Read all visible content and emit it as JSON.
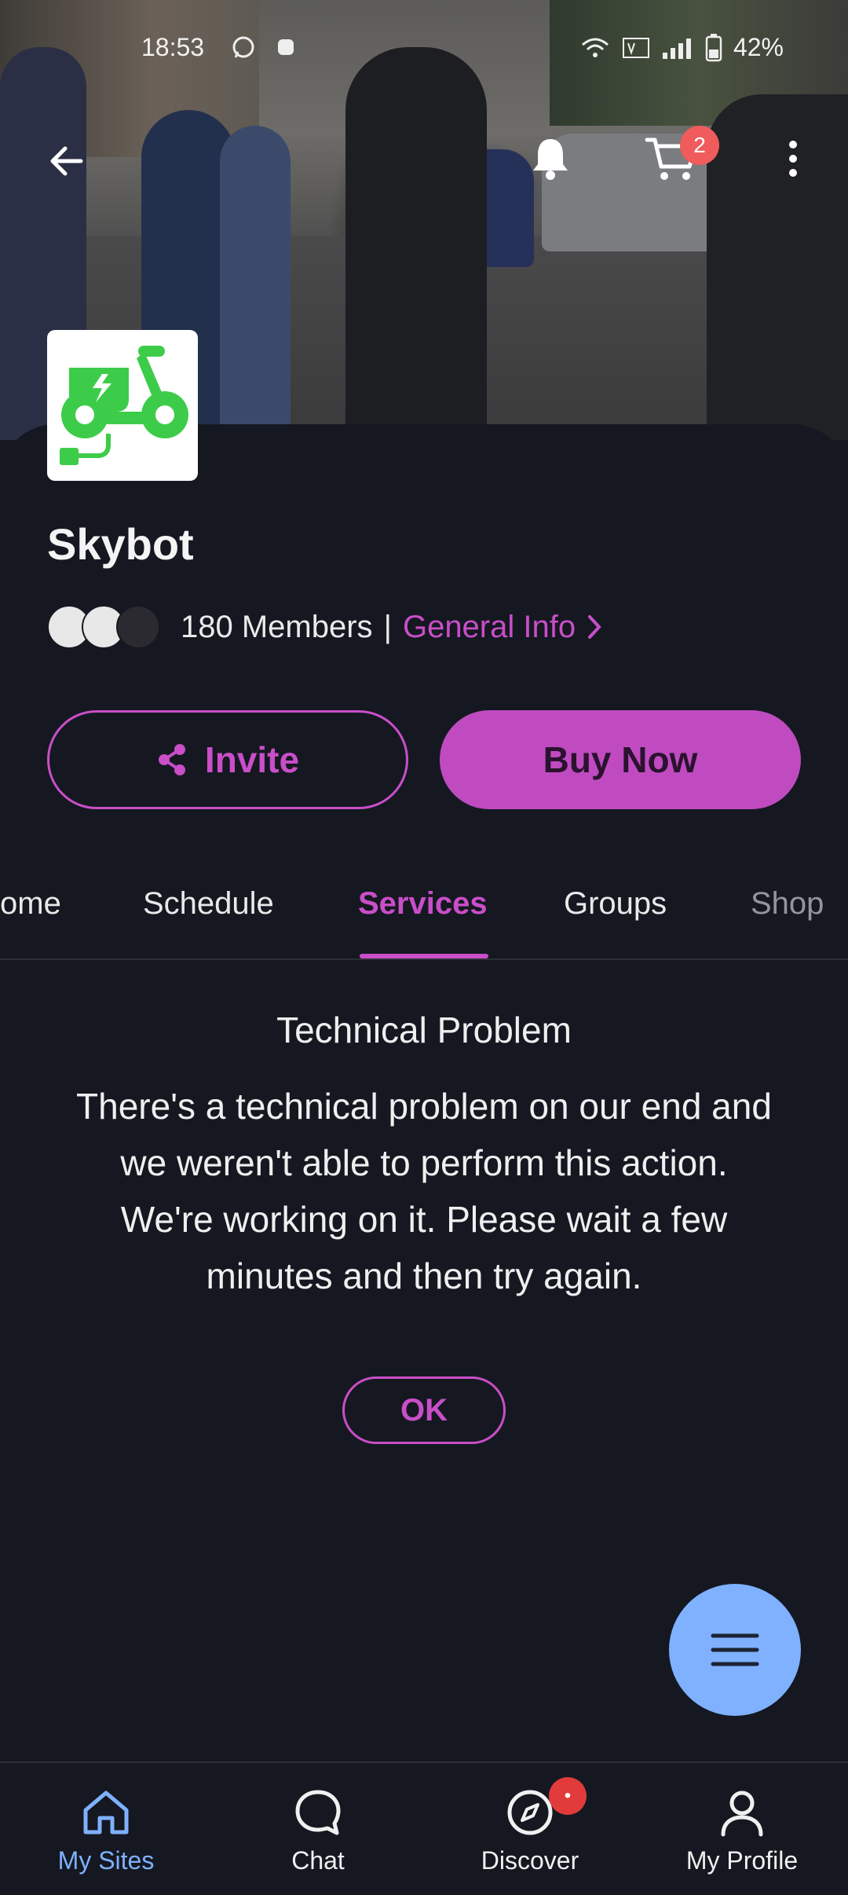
{
  "status_bar": {
    "time": "18:53",
    "battery": "42%",
    "icons": [
      "whatsapp-icon",
      "notification-icon",
      "wifi-icon",
      "volte-icon",
      "signal-icon",
      "battery-icon"
    ]
  },
  "top_bar": {
    "back_icon": "arrow-left-icon",
    "bell_icon": "bell-icon",
    "cart_icon": "cart-icon",
    "cart_count": "2",
    "more_icon": "more-vertical-icon"
  },
  "site": {
    "name": "Skybot",
    "logo_icon": "electric-scooter-icon",
    "logo_color": "#3dcc4a",
    "members": "180 Members",
    "separator": "|",
    "general_info": "General Info"
  },
  "actions": {
    "invite_label": "Invite",
    "buy_label": "Buy Now"
  },
  "tabs": [
    {
      "label": "ome"
    },
    {
      "label": "Schedule"
    },
    {
      "label": "Services",
      "active": true
    },
    {
      "label": "Groups"
    },
    {
      "label": "Shop"
    }
  ],
  "error": {
    "title": "Technical Problem",
    "message": "There's a technical problem on our end and we weren't able to perform this action. We're working on it. Please wait a few minutes and then try again.",
    "ok_label": "OK"
  },
  "fab": {
    "icon": "menu-icon"
  },
  "bottom_nav": [
    {
      "label": "My Sites",
      "icon": "home-icon",
      "active": true
    },
    {
      "label": "Chat",
      "icon": "chat-bubble-icon"
    },
    {
      "label": "Discover",
      "icon": "compass-icon",
      "dot": "•"
    },
    {
      "label": "My Profile",
      "icon": "user-icon"
    }
  ],
  "colors": {
    "accent": "#c94ec8",
    "background": "#151821",
    "nav_active": "#7fb1ff",
    "badge": "#f05b5b"
  }
}
